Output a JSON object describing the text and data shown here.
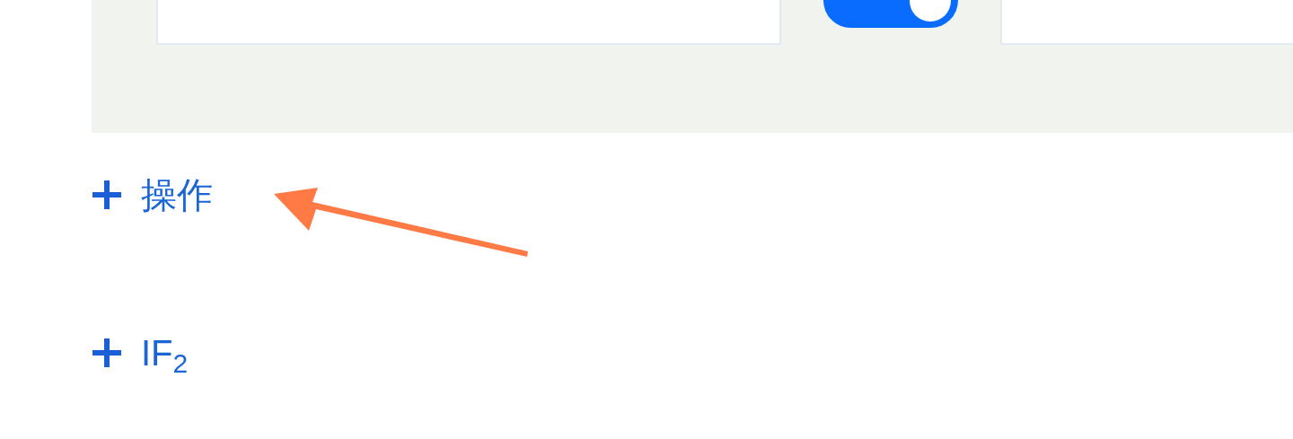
{
  "settings_panel": {
    "toggle": {
      "on": true
    }
  },
  "sections": [
    {
      "label": "操作",
      "expanded": false
    },
    {
      "label": "IF$_{2}$",
      "expanded": false
    }
  ]
}
